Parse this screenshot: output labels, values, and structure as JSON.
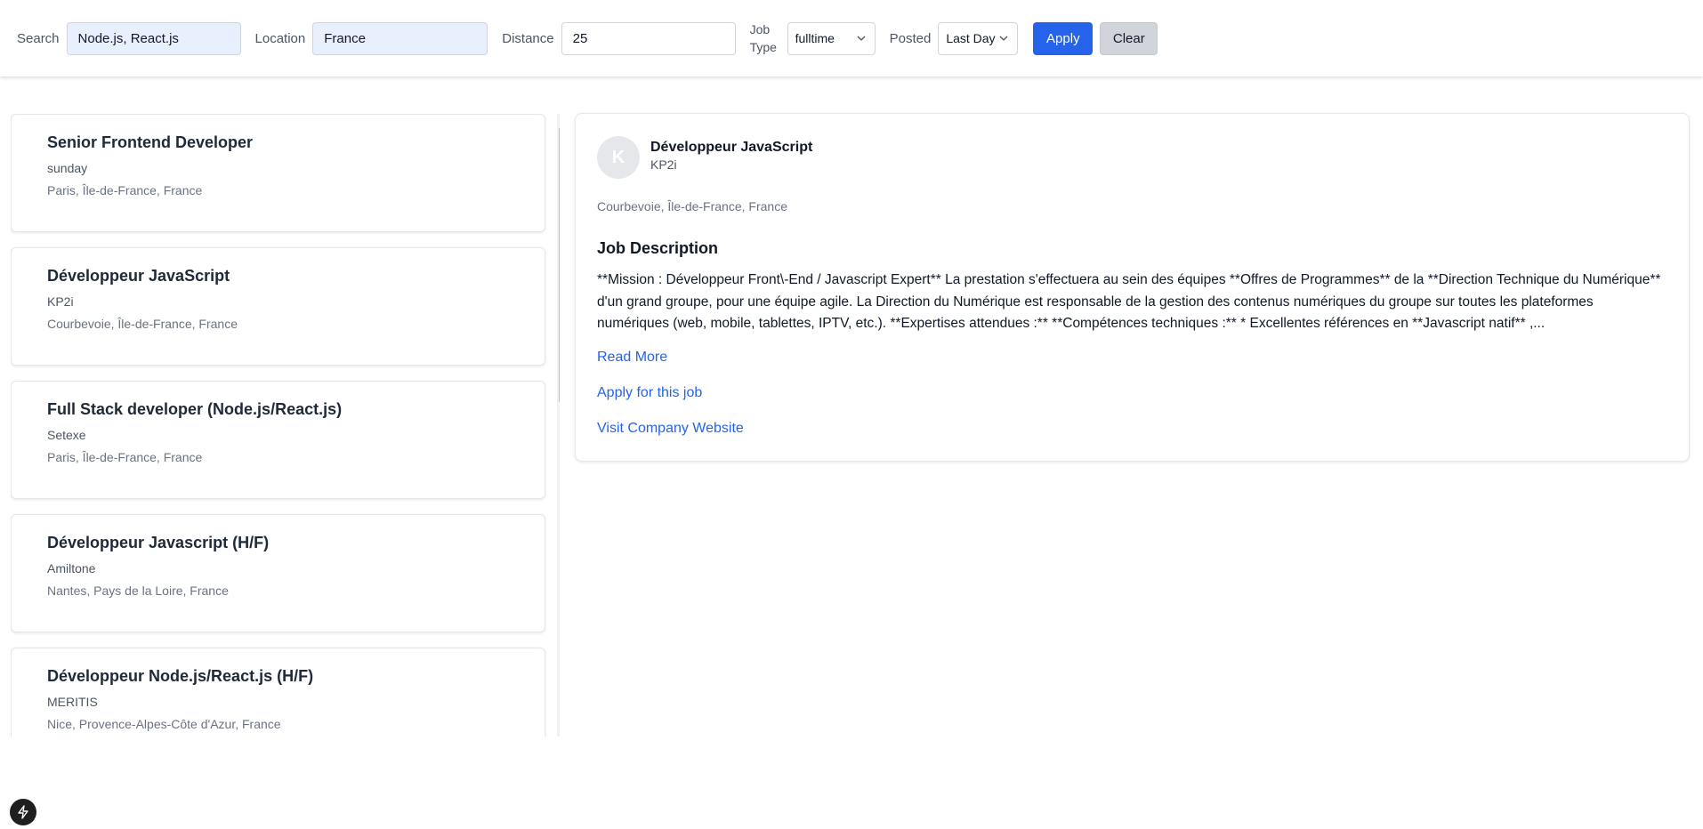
{
  "filters": {
    "search_label": "Search",
    "search_value": "Node.js, React.js",
    "location_label": "Location",
    "location_value": "France",
    "distance_label": "Distance",
    "distance_value": "25",
    "job_type_label_line1": "Job",
    "job_type_label_line2": "Type",
    "job_type_value": "fulltime",
    "posted_label": "Posted",
    "posted_value": "Last Day",
    "apply_label": "Apply",
    "clear_label": "Clear"
  },
  "jobs": [
    {
      "title": "Senior Frontend Developer",
      "company": "sunday",
      "location": "Paris, Île-de-France, France"
    },
    {
      "title": "Développeur JavaScript",
      "company": "KP2i",
      "location": "Courbevoie, Île-de-France, France"
    },
    {
      "title": "Full Stack developer (Node.js/React.js)",
      "company": "Setexe",
      "location": "Paris, Île-de-France, France"
    },
    {
      "title": "Développeur Javascript (H/F)",
      "company": "Amiltone",
      "location": "Nantes, Pays de la Loire, France"
    },
    {
      "title": "Développeur Node.js/React.js (H/F)",
      "company": "MERITIS",
      "location": "Nice, Provence-Alpes-Côte d'Azur, France"
    }
  ],
  "detail": {
    "avatar_letter": "K",
    "title": "Développeur JavaScript",
    "company": "KP2i",
    "location": "Courbevoie, Île-de-France, France",
    "heading": "Job Description",
    "description": "**Mission : Développeur Front\\-End / Javascript Expert** La prestation s'effectuera au sein des équipes **Offres de Programmes** de la **Direction Technique du Numérique** d'un grand groupe, pour une équipe agile. La Direction du Numérique est responsable de la gestion des contenus numériques du groupe sur toutes les plateformes numériques (web, mobile, tablettes, IPTV, etc.). **Expertises attendues :** **Compétences techniques :** * Excellentes références en **Javascript natif** ,...",
    "read_more": "Read More",
    "apply_link": "Apply for this job",
    "website_link": "Visit Company Website"
  },
  "colors": {
    "accent": "#2563eb",
    "input_filled_bg": "#e8f0fe"
  },
  "icons": {
    "dropdown": "chevron-down-icon",
    "badge": "bolt-icon"
  }
}
